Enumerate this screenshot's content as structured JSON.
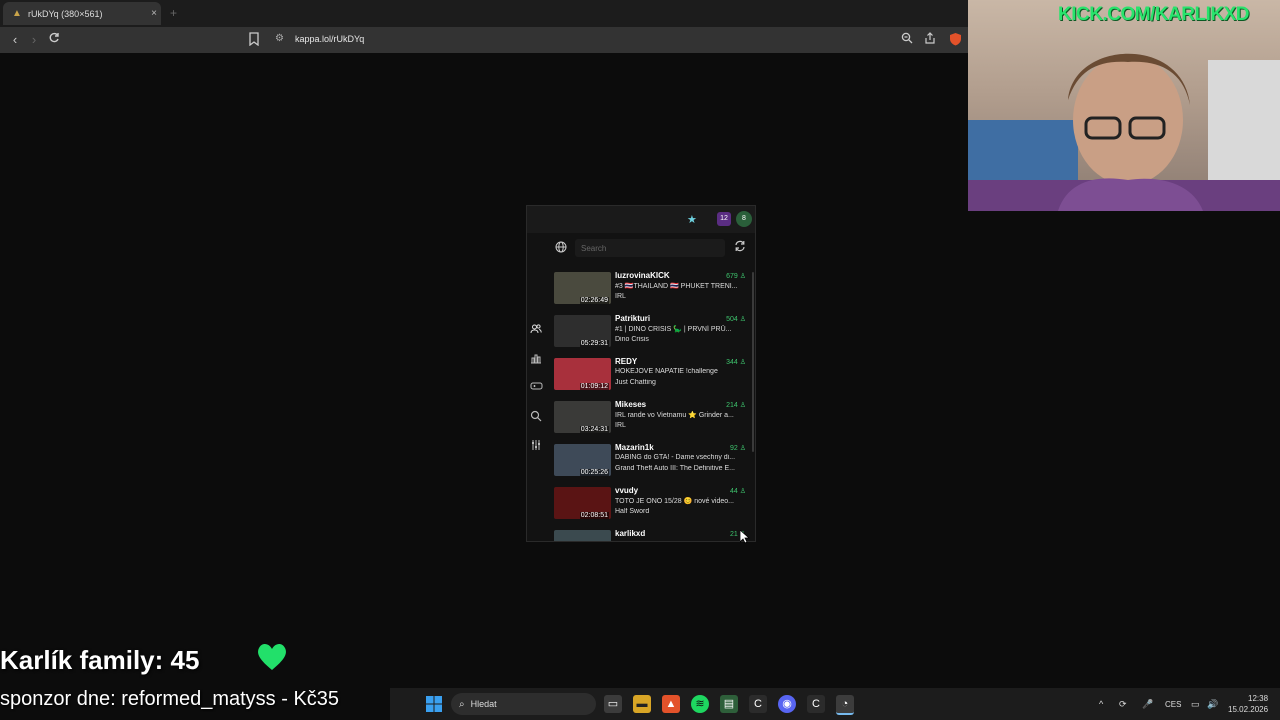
{
  "browser": {
    "tab_title": "rUkDYq (380×561)",
    "tab_close": "×",
    "new_tab": "+",
    "url": "kappa.lol/rUkDYq"
  },
  "popup": {
    "search_placeholder": "Search",
    "ext_badge_a": "12",
    "ext_badge_b": "8",
    "streams": [
      {
        "name": "luzrovinaKICK",
        "title": "#3 🇹🇭THAILAND 🇹🇭 PHUKET TRENI...",
        "category": "IRL",
        "viewers": "679",
        "duration": "02:26:49",
        "thumb": "#4a4a3e"
      },
      {
        "name": "Patrikturi",
        "title": "#1 | DINO CRISIS 🦕 | PRVNÍ PRŮ...",
        "category": "Dino Crisis",
        "viewers": "504",
        "duration": "05:29:31",
        "thumb": "#2e2e2e"
      },
      {
        "name": "REDY",
        "title": "HOKEJOVE NAPATIE !challenge",
        "category": "Just Chatting",
        "viewers": "344",
        "duration": "01:09:12",
        "thumb": "#a8303c"
      },
      {
        "name": "Mikeses",
        "title": "IRL rande vo Vietnamu ⭐ Grinder a...",
        "category": "IRL",
        "viewers": "214",
        "duration": "03:24:31",
        "thumb": "#3a3a38"
      },
      {
        "name": "Mazarin1k",
        "title": "DABING do GTA! - Dame vsechny di...",
        "category": "Grand Theft Auto III: The Definitive E...",
        "viewers": "92",
        "duration": "00:25:26",
        "thumb": "#3e4a58"
      },
      {
        "name": "vvudy",
        "title": "TOTO JE ONO 15/28 😊 nové video...",
        "category": "Half Sword",
        "viewers": "44",
        "duration": "02:08:51",
        "thumb": "#5a1414"
      },
      {
        "name": "karlikxd",
        "title": "",
        "category": "",
        "viewers": "21",
        "duration": "",
        "thumb": "#3b4a4f"
      }
    ]
  },
  "webcam": {
    "banner": "KICK.COM/KARLIKXD"
  },
  "overlay": {
    "family": "Karlík family: 45",
    "sponsor": "sponzor dne: reformed_matyss - Kč35",
    "heart_color": "#22e06a"
  },
  "taskbar": {
    "search_label": "Hledat",
    "language": "CES",
    "time": "12:38",
    "date": "15.02.2026"
  }
}
